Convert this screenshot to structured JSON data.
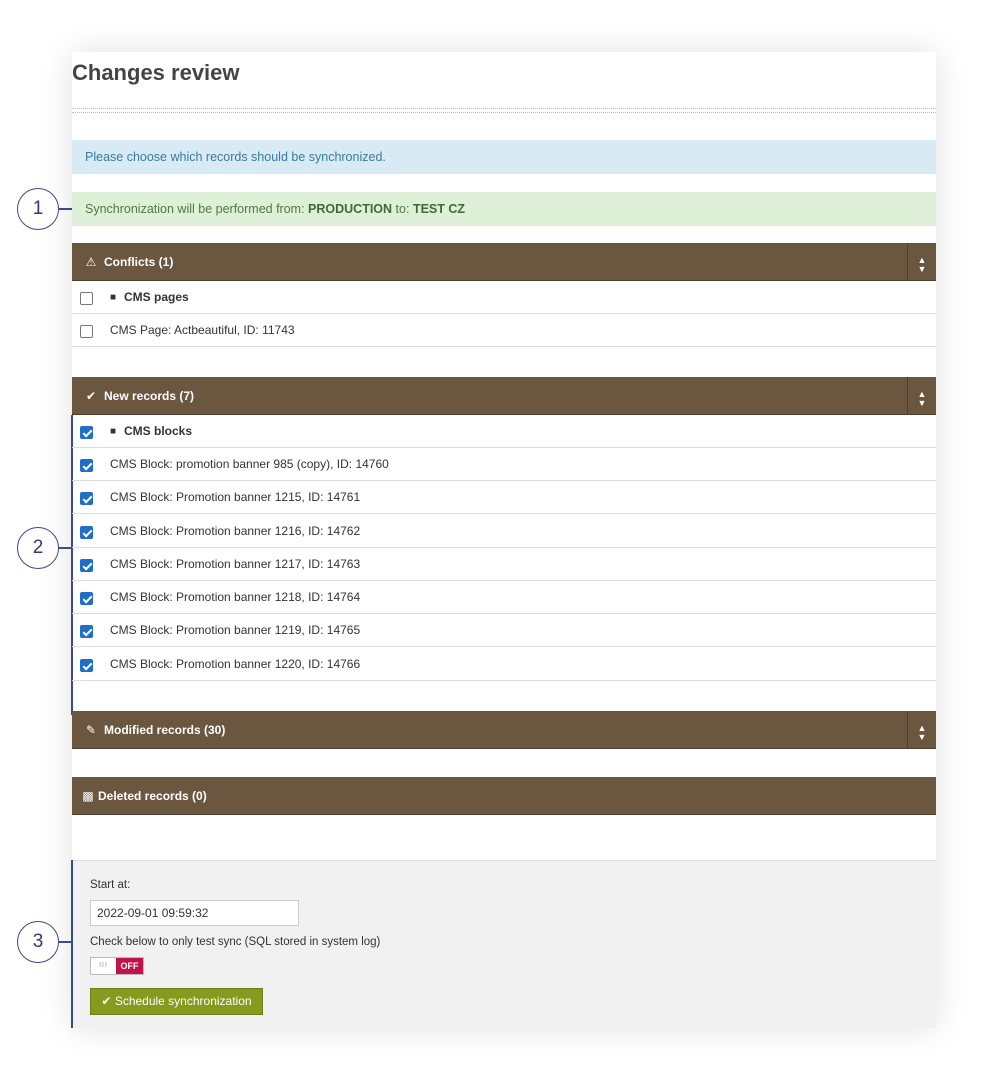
{
  "page": {
    "title": "Changes review"
  },
  "alerts": {
    "info": "Please choose which records should be synchronized.",
    "success_prefix": "Synchronization will be performed from:",
    "source": "PRODUCTION",
    "to_label": "to:",
    "target": "TEST CZ"
  },
  "callouts": [
    "1",
    "2",
    "3"
  ],
  "sections": {
    "conflicts": {
      "title": "Conflicts (1)",
      "icon": "warning-icon"
    },
    "new_records": {
      "title": "New records (7)",
      "icon": "check-icon"
    },
    "modified": {
      "title": "Modified records (30)",
      "icon": "pencil-icon"
    },
    "deleted": {
      "title": "Deleted records (0)",
      "icon": "trash-icon"
    }
  },
  "conflict_rows": {
    "group": {
      "label": "CMS pages",
      "checked": false
    },
    "items": [
      {
        "label": "CMS Page: Actbeautiful, ID: 11743",
        "checked": false
      }
    ]
  },
  "new_rows": {
    "group": {
      "label": "CMS blocks",
      "checked": true
    },
    "items": [
      {
        "label": "CMS Block: promotion banner 985 (copy), ID: 14760",
        "checked": true
      },
      {
        "label": "CMS Block: Promotion banner 1215, ID: 14761",
        "checked": true
      },
      {
        "label": "CMS Block: Promotion banner 1216, ID: 14762",
        "checked": true
      },
      {
        "label": "CMS Block: Promotion banner 1217, ID: 14763",
        "checked": true
      },
      {
        "label": "CMS Block: Promotion banner 1218, ID: 14764",
        "checked": true
      },
      {
        "label": "CMS Block: Promotion banner 1219, ID: 14765",
        "checked": true
      },
      {
        "label": "CMS Block: Promotion banner 1220, ID: 14766",
        "checked": true
      }
    ]
  },
  "footer": {
    "start_label": "Start at:",
    "start_value": "2022-09-01 09:59:32",
    "test_label": "Check below to only test sync (SQL stored in system log)",
    "toggle_state": "OFF",
    "toggle_knob": "III",
    "schedule_button": "Schedule synchronization"
  },
  "colors": {
    "section_header": "#6b5640",
    "info_bg": "#d8eaf4",
    "success_bg": "#dff0d8",
    "checkbox": "#1f6ec9",
    "toggle_off": "#c0134a",
    "schedule_button": "#849b1e",
    "callout": "#3a4a8a"
  }
}
